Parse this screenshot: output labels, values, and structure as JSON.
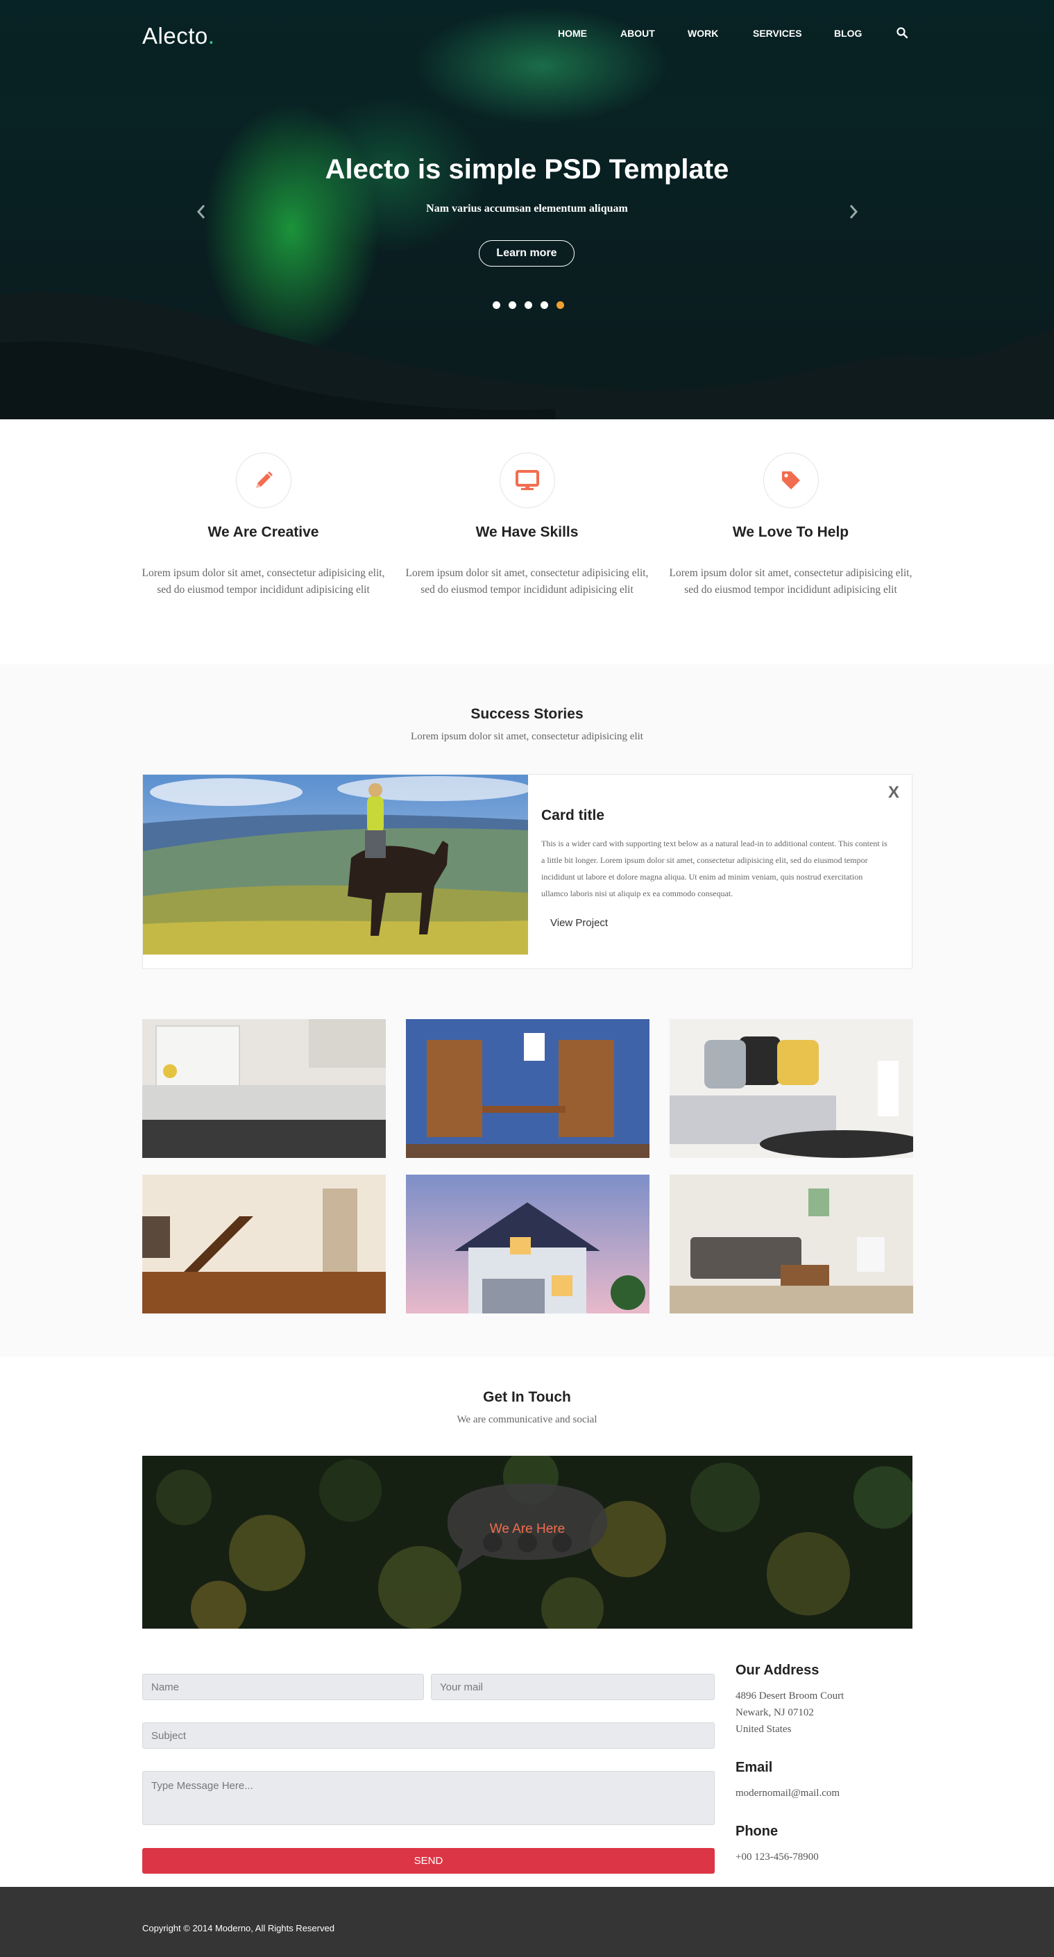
{
  "header": {
    "logo": "Alecto",
    "logo_dot": ".",
    "nav": [
      "HOME",
      "ABOUT",
      "WORK",
      "SERVICES",
      "BLOG"
    ]
  },
  "hero": {
    "title_bold": "Alecto",
    "title_rest": " is simple PSD Template",
    "subtitle": "Nam varius accumsan elementum aliquam",
    "button": "Learn more",
    "slides_total": 5,
    "active_slide": 5
  },
  "features": [
    {
      "icon": "pencil-icon",
      "title": "We Are Creative",
      "text": "Lorem ipsum dolor sit amet, consectetur adipisicing elit, sed do eiusmod tempor incididunt adipisicing elit"
    },
    {
      "icon": "monitor-icon",
      "title": "We Have Skills",
      "text": "Lorem ipsum dolor sit amet, consectetur adipisicing elit, sed do eiusmod tempor incididunt adipisicing elit"
    },
    {
      "icon": "tag-icon",
      "title": "We Love To Help",
      "text": "Lorem ipsum dolor sit amet, consectetur adipisicing elit, sed do eiusmod tempor incididunt adipisicing elit"
    }
  ],
  "success": {
    "title": "Success Stories",
    "subtitle": "Lorem ipsum dolor sit amet, consectetur adipisicing elit",
    "card": {
      "close": "X",
      "title": "Card title",
      "text": "This is a wider card with supporting text below as a natural lead-in to additional content. This content is a little bit longer. Lorem ipsum dolor sit amet, consectetur adipisicing elit, sed do eiusmod tempor incididunt ut labore et dolore magna aliqua. Ut enim ad minim veniam, quis nostrud exercitation ullamco laboris nisi ut aliquip ex ea commodo consequat.",
      "link": "View Project"
    }
  },
  "contact": {
    "title": "Get In Touch",
    "subtitle": "We are communicative and social",
    "map_label": "We Are Here",
    "form": {
      "name_placeholder": "Name",
      "mail_placeholder": "Your mail",
      "subject_placeholder": "Subject",
      "message_placeholder": "Type Message Here...",
      "send": "SEND"
    },
    "address_title": "Our Address",
    "address_line1": "4896 Desert Broom Court",
    "address_line2": "Newark, NJ 07102",
    "address_line3": "United States",
    "email_title": "Email",
    "email": "modernomail@mail.com",
    "phone_title": "Phone",
    "phone": "+00 123-456-78900"
  },
  "footer": {
    "copyright": "Copyright © 2014 Moderno, All Rights Reserved"
  },
  "colors": {
    "accent": "#f26d4f",
    "send_button": "#dc3545",
    "footer_bg": "#353535",
    "active_dot": "#f0a030"
  }
}
